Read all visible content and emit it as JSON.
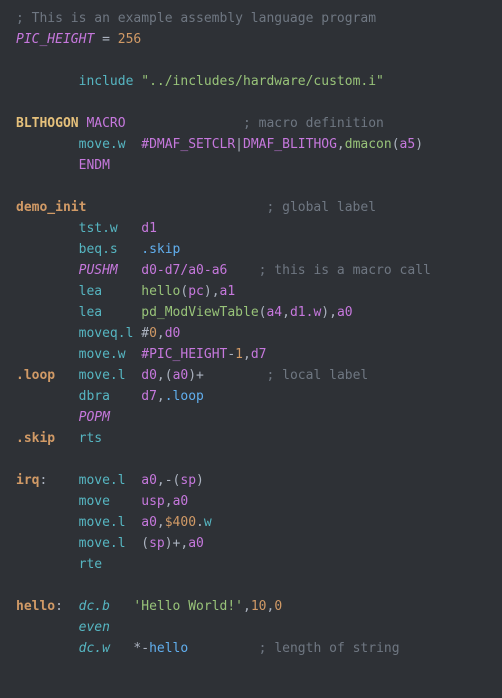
{
  "lines": [
    [
      {
        "cls": "c-comment",
        "t": "; This is an example assembly language program"
      }
    ],
    [
      {
        "cls": "c-builtin-i",
        "t": "PIC_HEIGHT"
      },
      {
        "cls": "c-op",
        "t": " = "
      },
      {
        "cls": "c-num",
        "t": "256"
      }
    ],
    [],
    [
      {
        "cls": "c-op",
        "t": "        "
      },
      {
        "cls": "c-type",
        "t": "include"
      },
      {
        "cls": "c-op",
        "t": " "
      },
      {
        "cls": "c-string",
        "t": "\"../includes/hardware/custom.i\""
      }
    ],
    [],
    [
      {
        "cls": "c-def",
        "t": "BLTHOGON"
      },
      {
        "cls": "c-op",
        "t": " "
      },
      {
        "cls": "c-keyword",
        "t": "MACRO"
      },
      {
        "cls": "c-op",
        "t": "               "
      },
      {
        "cls": "c-comment",
        "t": "; macro definition"
      }
    ],
    [
      {
        "cls": "c-op",
        "t": "        "
      },
      {
        "cls": "c-type",
        "t": "move.w"
      },
      {
        "cls": "c-op",
        "t": "  "
      },
      {
        "cls": "c-builtin",
        "t": "#DMAF_SETCLR"
      },
      {
        "cls": "c-op",
        "t": "|"
      },
      {
        "cls": "c-builtin",
        "t": "DMAF_BLITHOG"
      },
      {
        "cls": "c-op",
        "t": ","
      },
      {
        "cls": "c-string",
        "t": "dmacon"
      },
      {
        "cls": "c-op",
        "t": "("
      },
      {
        "cls": "c-magenta",
        "t": "a5"
      },
      {
        "cls": "c-op",
        "t": ")"
      }
    ],
    [
      {
        "cls": "c-op",
        "t": "        "
      },
      {
        "cls": "c-keyword",
        "t": "ENDM"
      }
    ],
    [],
    [
      {
        "cls": "c-label",
        "t": "demo_init"
      },
      {
        "cls": "c-op",
        "t": "                       "
      },
      {
        "cls": "c-comment",
        "t": "; global label"
      }
    ],
    [
      {
        "cls": "c-op",
        "t": "        "
      },
      {
        "cls": "c-type",
        "t": "tst.w"
      },
      {
        "cls": "c-op",
        "t": "   "
      },
      {
        "cls": "c-magenta",
        "t": "d1"
      }
    ],
    [
      {
        "cls": "c-op",
        "t": "        "
      },
      {
        "cls": "c-type",
        "t": "beq.s"
      },
      {
        "cls": "c-op",
        "t": "   "
      },
      {
        "cls": "c-func",
        "t": ".skip"
      }
    ],
    [
      {
        "cls": "c-op",
        "t": "        "
      },
      {
        "cls": "c-builtin-i",
        "t": "PUSHM"
      },
      {
        "cls": "c-op",
        "t": "   "
      },
      {
        "cls": "c-magenta",
        "t": "d0-d7/a0-a6"
      },
      {
        "cls": "c-op",
        "t": "    "
      },
      {
        "cls": "c-comment",
        "t": "; this is a macro call"
      }
    ],
    [
      {
        "cls": "c-op",
        "t": "        "
      },
      {
        "cls": "c-type",
        "t": "lea"
      },
      {
        "cls": "c-op",
        "t": "     "
      },
      {
        "cls": "c-string",
        "t": "hello"
      },
      {
        "cls": "c-op",
        "t": "("
      },
      {
        "cls": "c-magenta",
        "t": "pc"
      },
      {
        "cls": "c-op",
        "t": "),"
      },
      {
        "cls": "c-magenta",
        "t": "a1"
      }
    ],
    [
      {
        "cls": "c-op",
        "t": "        "
      },
      {
        "cls": "c-type",
        "t": "lea"
      },
      {
        "cls": "c-op",
        "t": "     "
      },
      {
        "cls": "c-string",
        "t": "pd_ModViewTable"
      },
      {
        "cls": "c-op",
        "t": "("
      },
      {
        "cls": "c-magenta",
        "t": "a4"
      },
      {
        "cls": "c-op",
        "t": ","
      },
      {
        "cls": "c-magenta",
        "t": "d1.w"
      },
      {
        "cls": "c-op",
        "t": "),"
      },
      {
        "cls": "c-magenta",
        "t": "a0"
      }
    ],
    [
      {
        "cls": "c-op",
        "t": "        "
      },
      {
        "cls": "c-type",
        "t": "moveq.l"
      },
      {
        "cls": "c-op",
        "t": " #"
      },
      {
        "cls": "c-num",
        "t": "0"
      },
      {
        "cls": "c-op",
        "t": ","
      },
      {
        "cls": "c-magenta",
        "t": "d0"
      }
    ],
    [
      {
        "cls": "c-op",
        "t": "        "
      },
      {
        "cls": "c-type",
        "t": "move.w"
      },
      {
        "cls": "c-op",
        "t": "  "
      },
      {
        "cls": "c-builtin",
        "t": "#PIC_HEIGHT"
      },
      {
        "cls": "c-op",
        "t": "-"
      },
      {
        "cls": "c-num",
        "t": "1"
      },
      {
        "cls": "c-op",
        "t": ","
      },
      {
        "cls": "c-magenta",
        "t": "d7"
      }
    ],
    [
      {
        "cls": "c-label",
        "t": ".loop"
      },
      {
        "cls": "c-op",
        "t": "   "
      },
      {
        "cls": "c-type",
        "t": "move.l"
      },
      {
        "cls": "c-op",
        "t": "  "
      },
      {
        "cls": "c-magenta",
        "t": "d0"
      },
      {
        "cls": "c-op",
        "t": ",("
      },
      {
        "cls": "c-magenta",
        "t": "a0"
      },
      {
        "cls": "c-op",
        "t": ")+"
      },
      {
        "cls": "c-op",
        "t": "        "
      },
      {
        "cls": "c-comment",
        "t": "; local label"
      }
    ],
    [
      {
        "cls": "c-op",
        "t": "        "
      },
      {
        "cls": "c-type",
        "t": "dbra"
      },
      {
        "cls": "c-op",
        "t": "    "
      },
      {
        "cls": "c-magenta",
        "t": "d7"
      },
      {
        "cls": "c-op",
        "t": ","
      },
      {
        "cls": "c-func",
        "t": ".loop"
      }
    ],
    [
      {
        "cls": "c-op",
        "t": "        "
      },
      {
        "cls": "c-builtin-i",
        "t": "POPM"
      }
    ],
    [
      {
        "cls": "c-label",
        "t": ".skip"
      },
      {
        "cls": "c-op",
        "t": "   "
      },
      {
        "cls": "c-type",
        "t": "rts"
      }
    ],
    [],
    [
      {
        "cls": "c-label",
        "t": "irq"
      },
      {
        "cls": "c-op",
        "t": ":    "
      },
      {
        "cls": "c-type",
        "t": "move.l"
      },
      {
        "cls": "c-op",
        "t": "  "
      },
      {
        "cls": "c-magenta",
        "t": "a0"
      },
      {
        "cls": "c-op",
        "t": ",-("
      },
      {
        "cls": "c-magenta",
        "t": "sp"
      },
      {
        "cls": "c-op",
        "t": ")"
      }
    ],
    [
      {
        "cls": "c-op",
        "t": "        "
      },
      {
        "cls": "c-type",
        "t": "move"
      },
      {
        "cls": "c-op",
        "t": "    "
      },
      {
        "cls": "c-magenta",
        "t": "usp"
      },
      {
        "cls": "c-op",
        "t": ","
      },
      {
        "cls": "c-magenta",
        "t": "a0"
      }
    ],
    [
      {
        "cls": "c-op",
        "t": "        "
      },
      {
        "cls": "c-type",
        "t": "move.l"
      },
      {
        "cls": "c-op",
        "t": "  "
      },
      {
        "cls": "c-magenta",
        "t": "a0"
      },
      {
        "cls": "c-op",
        "t": ","
      },
      {
        "cls": "c-num",
        "t": "$400"
      },
      {
        "cls": "c-op",
        "t": "."
      },
      {
        "cls": "c-type",
        "t": "w"
      }
    ],
    [
      {
        "cls": "c-op",
        "t": "        "
      },
      {
        "cls": "c-type",
        "t": "move.l"
      },
      {
        "cls": "c-op",
        "t": "  ("
      },
      {
        "cls": "c-magenta",
        "t": "sp"
      },
      {
        "cls": "c-op",
        "t": ")+,"
      },
      {
        "cls": "c-magenta",
        "t": "a0"
      }
    ],
    [
      {
        "cls": "c-op",
        "t": "        "
      },
      {
        "cls": "c-type",
        "t": "rte"
      }
    ],
    [],
    [
      {
        "cls": "c-label",
        "t": "hello"
      },
      {
        "cls": "c-op",
        "t": ":  "
      },
      {
        "cls": "c-type-i",
        "t": "dc.b"
      },
      {
        "cls": "c-op",
        "t": "   "
      },
      {
        "cls": "c-string",
        "t": "'Hello World!'"
      },
      {
        "cls": "c-op",
        "t": ","
      },
      {
        "cls": "c-num",
        "t": "10"
      },
      {
        "cls": "c-op",
        "t": ","
      },
      {
        "cls": "c-num",
        "t": "0"
      }
    ],
    [
      {
        "cls": "c-op",
        "t": "        "
      },
      {
        "cls": "c-type-i",
        "t": "even"
      }
    ],
    [
      {
        "cls": "c-op",
        "t": "        "
      },
      {
        "cls": "c-type-i",
        "t": "dc.w"
      },
      {
        "cls": "c-op",
        "t": "   "
      },
      {
        "cls": "c-op",
        "t": "*-"
      },
      {
        "cls": "c-func",
        "t": "hello"
      },
      {
        "cls": "c-op",
        "t": "         "
      },
      {
        "cls": "c-comment",
        "t": "; length of string"
      }
    ]
  ]
}
